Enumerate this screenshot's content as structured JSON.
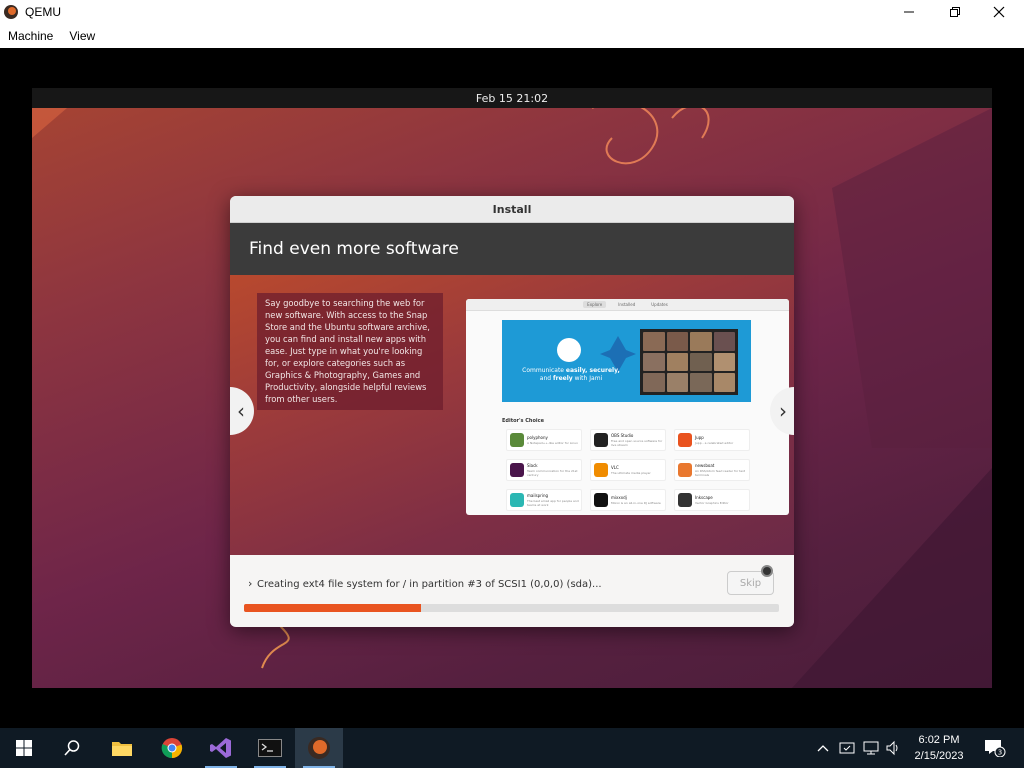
{
  "window": {
    "title": "QEMU",
    "menu": [
      "Machine",
      "View"
    ]
  },
  "vm": {
    "topbar_datetime": "Feb 15  21:02"
  },
  "installer": {
    "dialog_title": "Install",
    "slide_title": "Find even more software",
    "slide_text": "Say goodbye to searching the web for new software. With access to the Snap Store and the Ubuntu software archive, you can find and install new apps with ease. Just type in what you're looking for, or explore categories such as Graphics & Photography, Games and Productivity, alongside helpful reviews from other users.",
    "prev_glyph": "‹",
    "next_glyph": "›",
    "status": "Creating ext4 file system for / in partition #3 of SCSI1 (0,0,0) (sda)...",
    "skip_label": "Skip",
    "progress": 0.33,
    "accent": "#e95420"
  },
  "software_screenshot": {
    "tabs": [
      "Explore",
      "Installed",
      "Updates"
    ],
    "banner_text_1": "Communicate",
    "banner_text_bold": "easily, securely,",
    "banner_text_2": "and",
    "banner_text_bold_2": "freely",
    "banner_text_3": "with Jami",
    "editors_choice": "Editor's Choice",
    "apps": [
      {
        "name": "polyphony",
        "desc": "A Notepad++-like editor for Linux",
        "color": "#5a8a3a"
      },
      {
        "name": "OBS Studio",
        "desc": "Free and open source software for live stream",
        "color": "#222222"
      },
      {
        "name": "Jupp",
        "desc": "Jupp - a celebrated editor",
        "color": "#e9531f"
      },
      {
        "name": "Slack",
        "desc": "Team communication for the 21st century",
        "color": "#4a154b"
      },
      {
        "name": "VLC",
        "desc": "The ultimate media player",
        "color": "#f08c00"
      },
      {
        "name": "newsboat",
        "desc": "An RSS/Atom feed reader for text terminals",
        "color": "#e9782f"
      },
      {
        "name": "mailspring",
        "desc": "The best email app for people and teams at work",
        "color": "#2bb7b3"
      },
      {
        "name": "mixxxdj",
        "desc": "Mixxx is an all-in-one DJ software",
        "color": "#111111"
      },
      {
        "name": "Inkscape",
        "desc": "Vector Graphics Editor",
        "color": "#333333"
      }
    ]
  },
  "taskbar": {
    "time": "6:02 PM",
    "date": "2/15/2023",
    "notification_count": "3"
  }
}
